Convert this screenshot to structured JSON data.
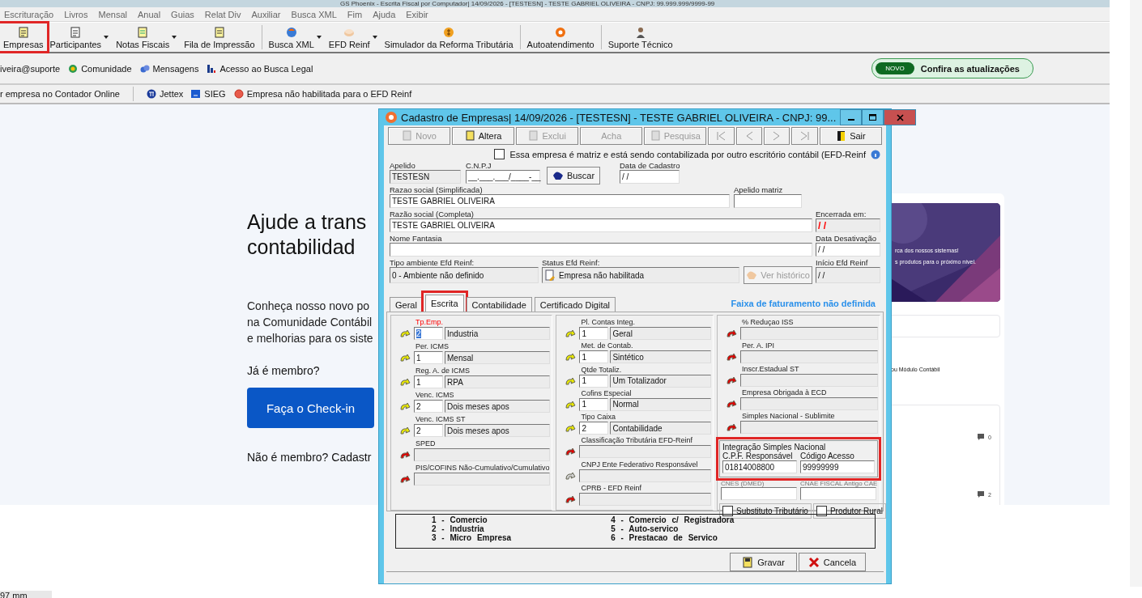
{
  "app": {
    "title": "GS Phoenix - Escrita Fiscal por Computador| 14/09/2026 - [TESTESN] - TESTE GABRIEL OLIVEIRA - CNPJ: 99.999.999/9999-99",
    "menu": [
      "Escrituração",
      "Livros",
      "Mensal",
      "Anual",
      "Guias",
      "Relat Div",
      "Auxiliar",
      "Busca XML",
      "Fim",
      "Ajuda",
      "Exibir"
    ],
    "toolbar": [
      [
        {
          "label": "Empresas",
          "dropdown": false,
          "highlighted": true
        },
        {
          "label": "Participantes",
          "dropdown": true,
          "highlighted": false
        },
        {
          "label": "Notas Fiscais",
          "dropdown": true,
          "highlighted": false
        },
        {
          "label": "Fila de Impressão",
          "dropdown": false,
          "highlighted": false
        }
      ],
      [
        {
          "label": "Busca XML",
          "dropdown": true,
          "highlighted": false
        },
        {
          "label": "EFD Reinf",
          "dropdown": true,
          "highlighted": false
        },
        {
          "label": "Simulador da Reforma Tributária",
          "dropdown": false,
          "highlighted": false
        }
      ],
      [
        {
          "label": "Autoatendimento",
          "dropdown": false,
          "highlighted": false
        }
      ],
      [
        {
          "label": "Suporte Técnico",
          "dropdown": false,
          "highlighted": false
        }
      ]
    ],
    "user": "iveira@suporte",
    "links": [
      "Comunidade",
      "Mensagens",
      "Acesso ao Busca Legal"
    ],
    "news": {
      "badge": "NOVO",
      "text": "Confira as atualizações"
    },
    "status_first": "r empresa no Contador Online",
    "status_links": [
      "Jettex",
      "SIEG",
      "Empresa não habilitada para o EFD Reinf"
    ],
    "footer": "97 mm"
  },
  "web": {
    "heading": [
      "Ajude a trans",
      "contabilidad"
    ],
    "intro": [
      "Conheça nosso novo po",
      "na Comunidade Contábil",
      "e melhorias para os siste"
    ],
    "member_prompt": "Já é membro?",
    "checkin_button": "Faça o Check-in",
    "signup_prompt": "Não é membro? Cadastr",
    "banner": [
      "rca dos nossos sistemas!",
      "s produtos para o próximo nível."
    ],
    "caption": "ou Módulo Contábil",
    "posts": [
      {
        "comments": "0"
      },
      {
        "comments": "2"
      }
    ]
  },
  "dialog": {
    "title": "Cadastro de Empresas|  14/09/2026 - [TESTESN] - TESTE GABRIEL OLIVEIRA - CNPJ: 99...",
    "toolbar": [
      {
        "kind": "text",
        "label": "Novo",
        "disabled": true
      },
      {
        "kind": "text",
        "label": "Altera",
        "disabled": false
      },
      {
        "kind": "text",
        "label": "Exclui",
        "disabled": true
      },
      {
        "kind": "text",
        "label": "Acha",
        "disabled": true
      },
      {
        "kind": "text",
        "label": "Pesquisa",
        "disabled": true
      },
      {
        "kind": "first",
        "disabled": true
      },
      {
        "kind": "prev",
        "disabled": true
      },
      {
        "kind": "next",
        "disabled": true
      },
      {
        "kind": "last",
        "disabled": true
      },
      {
        "kind": "text",
        "label": "Sair",
        "disabled": false
      }
    ],
    "matrix_check": {
      "label": "Essa empresa é matriz e está sendo contabilizada por outro escritório contábil (EFD-Reinf",
      "checked": false
    },
    "header": [
      [
        {
          "kind": "field",
          "label": "Apelido",
          "value": "TESTESN",
          "readonly": true
        },
        {
          "kind": "field",
          "label": "C.N.P.J",
          "value": "__.___.___/____-__",
          "readonly": false
        },
        {
          "kind": "button",
          "label": "Buscar",
          "disabled": false
        },
        {
          "kind": "field",
          "label": "Data de Cadastro",
          "value": " / /",
          "readonly": false
        }
      ],
      [
        {
          "kind": "field",
          "label": "Razao social (Simplificada)",
          "value": "TESTE GABRIEL OLIVEIRA",
          "readonly": false
        },
        {
          "kind": "field",
          "label": "Apelido matriz",
          "readonly": false
        }
      ],
      [
        {
          "kind": "field",
          "label": "Razão social (Completa)",
          "value": "TESTE GABRIEL OLIVEIRA",
          "readonly": false
        },
        {
          "kind": "field",
          "label": "Encerrada em:",
          "value": " / /",
          "readonly": true,
          "color": "#ff0000"
        }
      ],
      [
        {
          "kind": "field",
          "label": "Nome Fantasia",
          "readonly": false
        },
        {
          "kind": "field",
          "label": "Data Desativação",
          "value": " / /",
          "readonly": false
        }
      ],
      [
        {
          "kind": "field",
          "label": "Tipo ambiente Efd Reinf:",
          "value": "0 - Ambiente não definido",
          "readonly": true
        },
        {
          "kind": "status",
          "label": "Status Efd Reinf:",
          "value": "Empresa não habilitada",
          "readonly": true
        },
        {
          "kind": "button",
          "label": "Ver histórico",
          "disabled": true
        },
        {
          "kind": "field",
          "label": "Início Efd Reinf",
          "value": " / /",
          "readonly": true
        }
      ]
    ],
    "tabs": [
      {
        "label": "Geral",
        "selected": false,
        "highlighted": false
      },
      {
        "label": "Escrita",
        "selected": true,
        "highlighted": true
      },
      {
        "label": "Contabilidade",
        "selected": false,
        "highlighted": false
      },
      {
        "label": "Certificado Digital",
        "selected": false,
        "highlighted": false
      }
    ],
    "revenue_note": "Faixa de faturamento não definida",
    "columns": [
      [
        {
          "kind": "code",
          "label": "Tp.Emp.",
          "code": "2",
          "text": "Industria",
          "color": "#e8e800",
          "required": true,
          "focused": true
        },
        {
          "kind": "code",
          "label": "Per. ICMS",
          "code": "1",
          "text": "Mensal",
          "color": "#e8e800",
          "required": false,
          "focused": false
        },
        {
          "kind": "code",
          "label": "Reg. A. de ICMS",
          "code": "1",
          "text": "RPA",
          "color": "#e8e800",
          "required": false,
          "focused": false
        },
        {
          "kind": "code",
          "label": "Venc. ICMS",
          "code": "2",
          "text": "Dois meses apos",
          "color": "#e8e800",
          "required": false,
          "focused": false
        },
        {
          "kind": "code",
          "label": "Venc. ICMS ST",
          "code": "2",
          "text": "Dois meses apos",
          "color": "#e8e800",
          "required": false,
          "focused": false
        },
        {
          "kind": "blank",
          "label": "SPED",
          "color": "#e00000",
          "required": false
        },
        {
          "kind": "blank",
          "label": "PIS/COFINS Não-Cumulativo/Cumulativo",
          "color": "#e00000",
          "required": false
        }
      ],
      [
        {
          "kind": "code",
          "label": "Pl. Contas Integ.",
          "code": "1",
          "text": "Geral",
          "color": "#e8e800",
          "required": false,
          "focused": false
        },
        {
          "kind": "code",
          "label": "Met. de Contab.",
          "code": "1",
          "text": "Sintético",
          "color": "#e8e800",
          "required": false,
          "focused": false
        },
        {
          "kind": "code",
          "label": "Qtde Totaliz.",
          "code": "1",
          "text": "Um Totalizador",
          "color": "#e8e800",
          "required": false,
          "focused": false
        },
        {
          "kind": "code",
          "label": "Cofins Especial",
          "code": "1",
          "text": "Normal",
          "color": "#e8e800",
          "required": false,
          "focused": false
        },
        {
          "kind": "code",
          "label": "Tipo Caixa",
          "code": "2",
          "text": "Contabilidade",
          "color": "#e8e800",
          "required": false,
          "focused": false
        },
        {
          "kind": "blank",
          "label": "Classificação Tributária EFD-Reinf",
          "color": "#e00000",
          "required": false
        },
        {
          "kind": "blank",
          "label": "CNPJ Ente Federativo Responsável",
          "color": "#d0d0d0",
          "required": false
        },
        {
          "kind": "blank",
          "label": "CPRB - EFD Reinf",
          "color": "#e00000",
          "required": false
        }
      ],
      [
        {
          "kind": "blank",
          "label": "% Reduçao ISS",
          "color": "#e00000",
          "required": false
        },
        {
          "kind": "blank",
          "label": "Per. A. IPI",
          "color": "#e00000",
          "required": false
        },
        {
          "kind": "blank",
          "label": "Inscr.Estadual ST",
          "color": "#e00000",
          "required": false
        },
        {
          "kind": "blank",
          "label": "Empresa Obrigada à ECD",
          "color": "#e00000",
          "required": false
        },
        {
          "kind": "blank",
          "label": "Simples Nacional - Sublimite",
          "color": "#e00000",
          "required": false
        }
      ]
    ],
    "integration": {
      "title": "Integração Simples Nacional",
      "highlighted": true,
      "fields": [
        {
          "label": "C.P.F. Responsável",
          "value": "01814008800"
        },
        {
          "label": "Código Acesso",
          "value": "99999999"
        }
      ]
    },
    "extra_fields": [
      {
        "label": "CNES (DMED)"
      },
      {
        "label": "CNAE FISCAL Antigo CAE"
      }
    ],
    "checks": [
      {
        "label": "Substituto Tributário",
        "checked": false
      },
      {
        "label": "Produtor Rural",
        "checked": false
      }
    ],
    "legend": [
      "1 - Comercio",
      "2 - Industria",
      "3 - Micro Empresa",
      "4 - Comercio c/ Registradora",
      "5 - Auto-servico",
      "6 - Prestacao de Servico"
    ],
    "actions": [
      "Gravar",
      "Cancela"
    ]
  }
}
